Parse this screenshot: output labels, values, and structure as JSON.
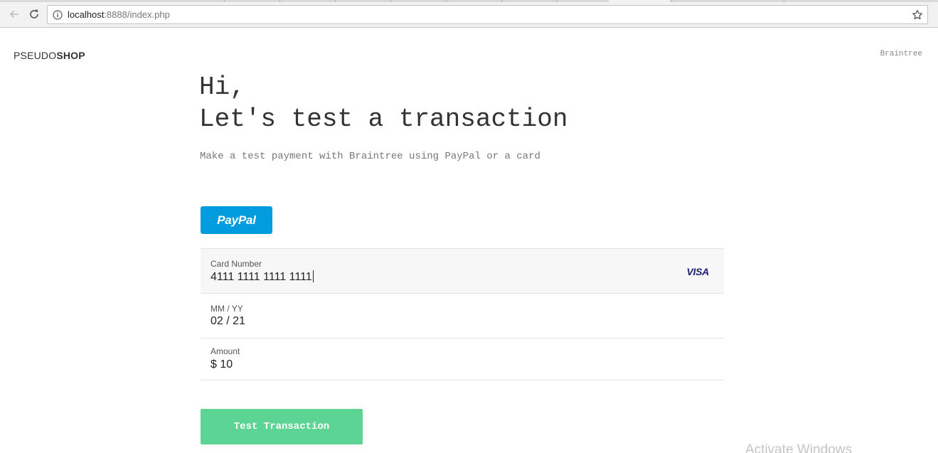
{
  "browser": {
    "url_host": "localhost",
    "url_rest": ":8888/index.php",
    "back_icon": "arrow-left-icon",
    "reload_icon": "reload-icon",
    "info_icon": "info-icon",
    "bookmark_icon": "star-icon"
  },
  "header": {
    "brand_light": "PSEUDO",
    "brand_bold": "SHOP",
    "nav_link": "Braintree"
  },
  "main": {
    "greeting": "Hi,",
    "title": "Let's test a transaction",
    "subtitle": "Make a test payment with Braintree using PayPal or a card",
    "paypal_label": "PayPal"
  },
  "form": {
    "card_number_label": "Card Number",
    "card_number_value": "4111 1111 1111 1111",
    "card_brand": "VISA",
    "expiry_label": "MM / YY",
    "expiry_value": "02 / 21",
    "amount_label": "Amount",
    "amount_value": "$ 10",
    "submit_label": "Test Transaction"
  },
  "overlay": {
    "watermark": "Activate Windows"
  },
  "colors": {
    "paypal_blue": "#009cde",
    "submit_green": "#5bd494",
    "visa_navy": "#1a1f71"
  }
}
